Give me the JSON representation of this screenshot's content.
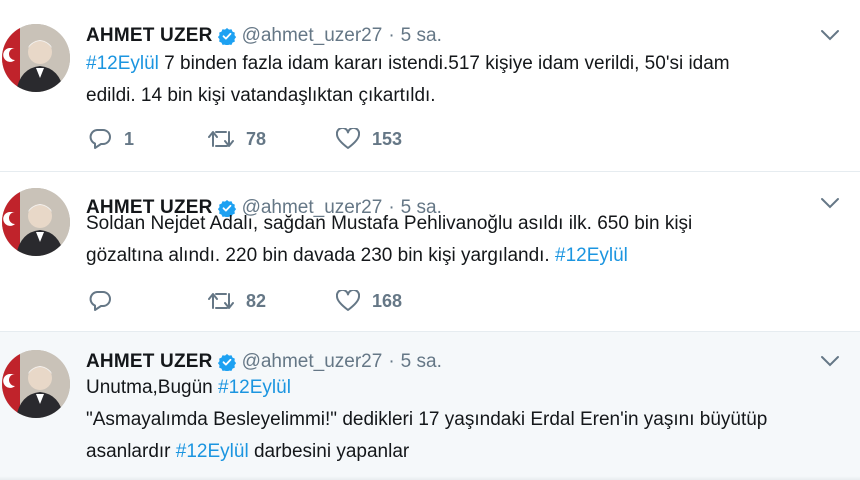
{
  "tweets": [
    {
      "name": "AHMET UZER",
      "handle": "@ahmet_uzer27",
      "separator": "·",
      "time": "5 sa.",
      "line1_hashtag": "#12Eylül",
      "line1_rest": " 7 binden fazla idam kararı istendi.517 kişiye idam verildi, 50'si idam",
      "line2": "edildi. 14 bin kişi vatandaşlıktan çıkartıldı.",
      "replies": "1",
      "retweets": "78",
      "likes": "153"
    },
    {
      "name": "AHMET UZER",
      "handle": "@ahmet_uzer27",
      "separator": "·",
      "time": "5 sa.",
      "line1": "Soldan Nejdet Adalı, sağdan Mustafa Pehlivanoğlu asıldı ilk. 650 bin kişi",
      "line2_text": "gözaltına alındı. 220 bin davada 230 bin kişi yargılandı. ",
      "line2_hashtag": "#12Eylül",
      "replies": "",
      "retweets": "82",
      "likes": "168"
    },
    {
      "name": "AHMET UZER",
      "handle": "@ahmet_uzer27",
      "separator": "·",
      "time": "5 sa.",
      "line1_text": "Unutma,Bugün ",
      "line1_hashtag": "#12Eylül",
      "line2": "\"Asmayalımda Besleyelimmi!\" dedikleri 17 yaşındaki Erdal Eren'in yaşını büyütüp",
      "line3_text": "asanlardır ",
      "line3_hashtag": "#12Eylül",
      "line3_rest": " darbesini yapanlar"
    }
  ],
  "icons": {
    "verified": "verified-badge-icon",
    "more": "chevron-down-icon",
    "reply": "reply-icon",
    "retweet": "retweet-icon",
    "like": "heart-icon"
  },
  "colors": {
    "hashtag": "#1b95e0",
    "verified": "#1da1f2",
    "muted": "#657786"
  }
}
